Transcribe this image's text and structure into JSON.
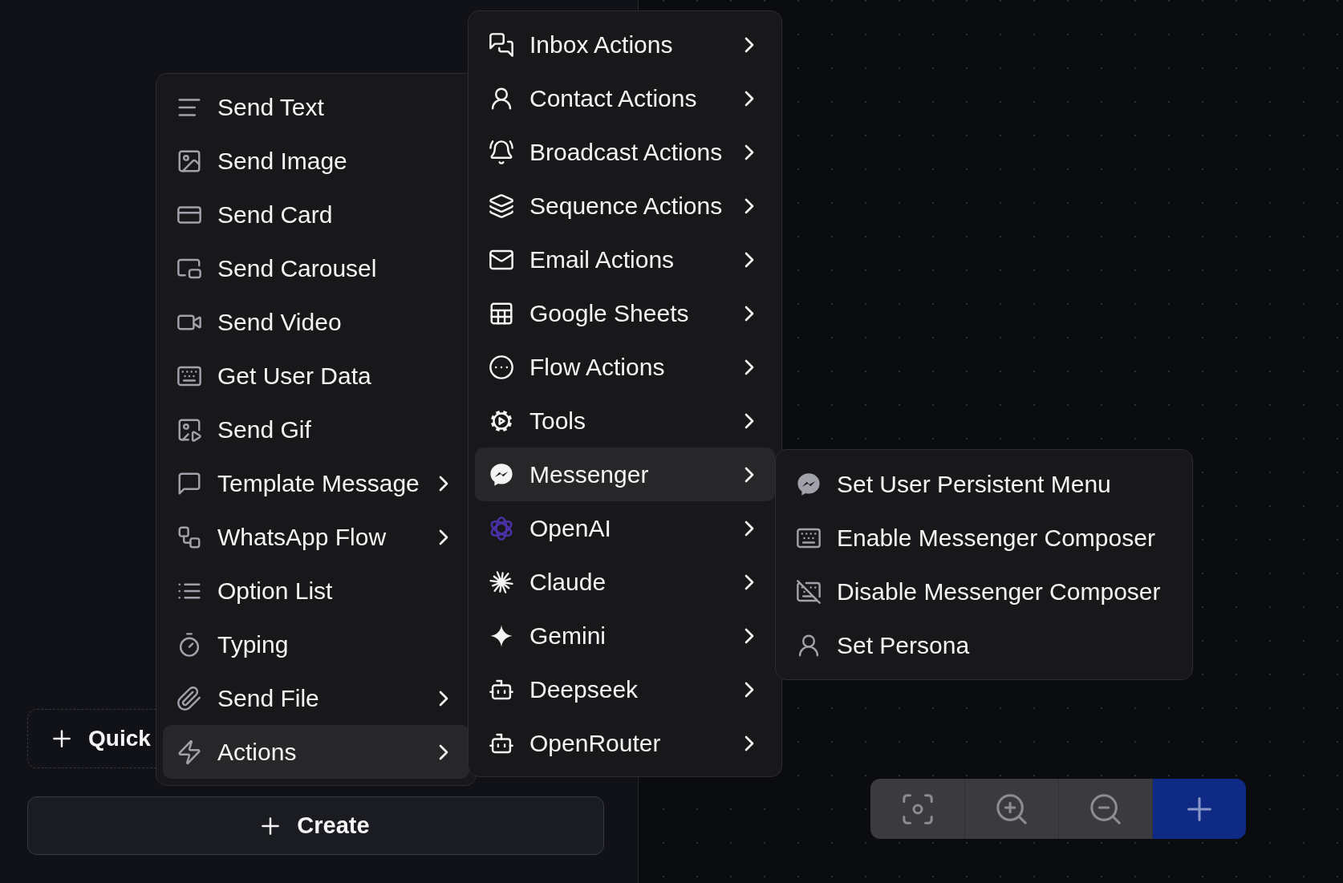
{
  "side_panel": {
    "quick_button": {
      "label": "Quick"
    },
    "create_button": {
      "label": "Create"
    }
  },
  "menus": [
    {
      "items": [
        {
          "label": "Send Text",
          "has_submenu": false,
          "selected": false
        },
        {
          "label": "Send Image",
          "has_submenu": false,
          "selected": false
        },
        {
          "label": "Send Card",
          "has_submenu": false,
          "selected": false
        },
        {
          "label": "Send Carousel",
          "has_submenu": false,
          "selected": false
        },
        {
          "label": "Send Video",
          "has_submenu": false,
          "selected": false
        },
        {
          "label": "Get User Data",
          "has_submenu": false,
          "selected": false
        },
        {
          "label": "Send Gif",
          "has_submenu": false,
          "selected": false
        },
        {
          "label": "Template Message",
          "has_submenu": true,
          "selected": false
        },
        {
          "label": "WhatsApp Flow",
          "has_submenu": true,
          "selected": false
        },
        {
          "label": "Option List",
          "has_submenu": false,
          "selected": false
        },
        {
          "label": "Typing",
          "has_submenu": false,
          "selected": false
        },
        {
          "label": "Send File",
          "has_submenu": true,
          "selected": false
        },
        {
          "label": "Actions",
          "has_submenu": true,
          "selected": true
        }
      ]
    },
    {
      "items": [
        {
          "label": "Inbox Actions",
          "has_submenu": true,
          "selected": false
        },
        {
          "label": "Contact Actions",
          "has_submenu": true,
          "selected": false
        },
        {
          "label": "Broadcast Actions",
          "has_submenu": true,
          "selected": false
        },
        {
          "label": "Sequence Actions",
          "has_submenu": true,
          "selected": false
        },
        {
          "label": "Email Actions",
          "has_submenu": true,
          "selected": false
        },
        {
          "label": "Google Sheets",
          "has_submenu": true,
          "selected": false
        },
        {
          "label": "Flow Actions",
          "has_submenu": true,
          "selected": false
        },
        {
          "label": "Tools",
          "has_submenu": true,
          "selected": false
        },
        {
          "label": "Messenger",
          "has_submenu": true,
          "selected": true
        },
        {
          "label": "OpenAI",
          "has_submenu": true,
          "selected": false
        },
        {
          "label": "Claude",
          "has_submenu": true,
          "selected": false
        },
        {
          "label": "Gemini",
          "has_submenu": true,
          "selected": false
        },
        {
          "label": "Deepseek",
          "has_submenu": true,
          "selected": false
        },
        {
          "label": "OpenRouter",
          "has_submenu": true,
          "selected": false
        }
      ]
    },
    {
      "items": [
        {
          "label": "Set User Persistent Menu",
          "has_submenu": false,
          "selected": false
        },
        {
          "label": "Enable Messenger Composer",
          "has_submenu": false,
          "selected": false
        },
        {
          "label": "Disable Messenger Composer",
          "has_submenu": false,
          "selected": false
        },
        {
          "label": "Set Persona",
          "has_submenu": false,
          "selected": false
        }
      ]
    }
  ]
}
